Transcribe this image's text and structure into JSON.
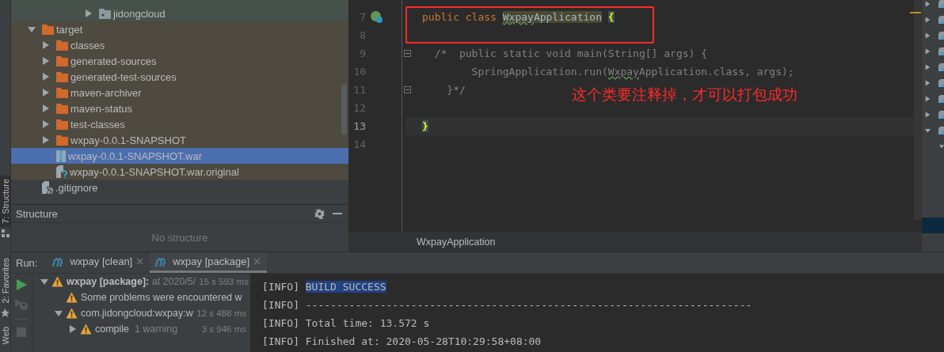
{
  "tool_strip": [
    {
      "label": "7: Structure",
      "selected": true
    },
    {
      "label": "2: Favorites",
      "selected": false
    },
    {
      "label": "Web",
      "selected": false
    }
  ],
  "project_tree": {
    "rows_above": [
      {
        "label": "jidongcloud",
        "kind": "package",
        "expanded": false,
        "selected": false
      }
    ],
    "items": [
      {
        "label": "target",
        "kind": "folder",
        "expanded": true,
        "selected": false,
        "excluded": true,
        "children": [
          {
            "label": "classes",
            "kind": "folder",
            "expanded": false,
            "selected": false,
            "excluded": true
          },
          {
            "label": "generated-sources",
            "kind": "folder",
            "expanded": false,
            "selected": false,
            "excluded": true
          },
          {
            "label": "generated-test-sources",
            "kind": "folder",
            "expanded": false,
            "selected": false,
            "excluded": true
          },
          {
            "label": "maven-archiver",
            "kind": "folder",
            "expanded": false,
            "selected": false,
            "excluded": true
          },
          {
            "label": "maven-status",
            "kind": "folder",
            "expanded": false,
            "selected": false,
            "excluded": true
          },
          {
            "label": "test-classes",
            "kind": "folder",
            "expanded": false,
            "selected": false,
            "excluded": true
          },
          {
            "label": "wxpay-0.0.1-SNAPSHOT",
            "kind": "folder",
            "expanded": false,
            "selected": false,
            "excluded": true
          },
          {
            "label": "wxpay-0.0.1-SNAPSHOT.war",
            "kind": "archive",
            "selected": true,
            "excluded": true
          },
          {
            "label": "wxpay-0.0.1-SNAPSHOT.war.original",
            "kind": "unknown_file",
            "selected": false,
            "excluded": true
          }
        ]
      },
      {
        "label": ".gitignore",
        "kind": "ignored_file",
        "selected": false,
        "excluded": false
      }
    ]
  },
  "structure": {
    "title": "Structure",
    "empty_text": "No structure"
  },
  "editor": {
    "lines": [
      {
        "number": "7",
        "gutter_icon": true,
        "fold": false,
        "current": false,
        "segments": [
          {
            "text": "public class",
            "kind": "keyword"
          },
          {
            "text": "Wxpay",
            "kind": "decl_typo"
          },
          {
            "text": "Application",
            "kind": "decl"
          },
          {
            "text": "{",
            "kind": "brace"
          }
        ]
      },
      {
        "number": "8",
        "gutter_icon": false,
        "fold": false,
        "current": false
      },
      {
        "number": "9",
        "gutter_icon": false,
        "fold": true,
        "current": false,
        "segments": [
          {
            "text": "  /*  public static void main(String[] args) {",
            "kind": "comment"
          }
        ]
      },
      {
        "number": "10",
        "gutter_icon": false,
        "fold": false,
        "current": false,
        "segments": [
          {
            "text": "        SpringApplication.run(",
            "kind": "comment"
          },
          {
            "text": "Wxpay",
            "kind": "comment_typo"
          },
          {
            "text": "Application.class, args);",
            "kind": "comment"
          }
        ]
      },
      {
        "number": "11",
        "gutter_icon": false,
        "fold": true,
        "current": false,
        "segments": [
          {
            "text": "    }*/",
            "kind": "comment"
          }
        ]
      },
      {
        "number": "12",
        "gutter_icon": false,
        "fold": false,
        "current": false
      },
      {
        "number": "13",
        "gutter_icon": false,
        "fold": false,
        "current": true,
        "segments": [
          {
            "text": "}",
            "kind": "brace"
          }
        ]
      },
      {
        "number": "14",
        "gutter_icon": false,
        "fold": false,
        "current": false
      }
    ],
    "annotation": "这个类要注释掉，才可以打包成功",
    "breadcrumb": "WxpayApplication"
  },
  "maven_panel": {
    "rows": [
      {
        "expanded": false
      },
      {
        "expanded": false
      },
      {
        "expanded": false
      },
      {
        "expanded": false
      },
      {
        "expanded": false
      },
      {
        "expanded": false
      },
      {
        "expanded": false
      },
      {
        "expanded": false
      },
      {
        "expanded": true,
        "children": [
          {
            "expanded": true
          }
        ]
      }
    ]
  },
  "run": {
    "label": "Run:",
    "tabs": [
      {
        "label": "wxpay [clean]",
        "selected": false
      },
      {
        "label": "wxpay [package]",
        "selected": true
      }
    ],
    "tree": [
      {
        "segments": [
          {
            "text": "wxpay [package]:",
            "kind": "bold"
          },
          {
            "text": " at 2020/5/",
            "kind": "muted"
          }
        ],
        "time": "15 s 593 ms",
        "expanded": true,
        "children": [
          {
            "segments": [
              {
                "text": "Some problems were encountered w",
                "kind": "plain"
              }
            ]
          },
          {
            "segments": [
              {
                "text": "com.jidongcloud:wxpay:w",
                "kind": "plain"
              }
            ],
            "time": "12 s 488 ms",
            "expanded": true,
            "children": [
              {
                "segments": [
                  {
                    "text": "compile",
                    "kind": "plain"
                  },
                  {
                    "text": "  1 warning",
                    "kind": "muted"
                  }
                ],
                "time": "3 s 946 ms",
                "expanded": false
              }
            ]
          }
        ]
      }
    ],
    "console": [
      {
        "segments": [
          {
            "text": "[INFO] ",
            "selected": false
          },
          {
            "text": "BUILD SUCCESS",
            "selected": true
          }
        ]
      },
      {
        "segments": [
          {
            "text": "[INFO] ------------------------------------------------------------------------",
            "selected": false
          }
        ]
      },
      {
        "segments": [
          {
            "text": "[INFO] Total time: 13.572 s",
            "selected": false
          }
        ]
      },
      {
        "segments": [
          {
            "text": "[INFO] Finished at: 2020-05-28T10:29:58+08:00",
            "selected": false
          }
        ]
      }
    ]
  }
}
